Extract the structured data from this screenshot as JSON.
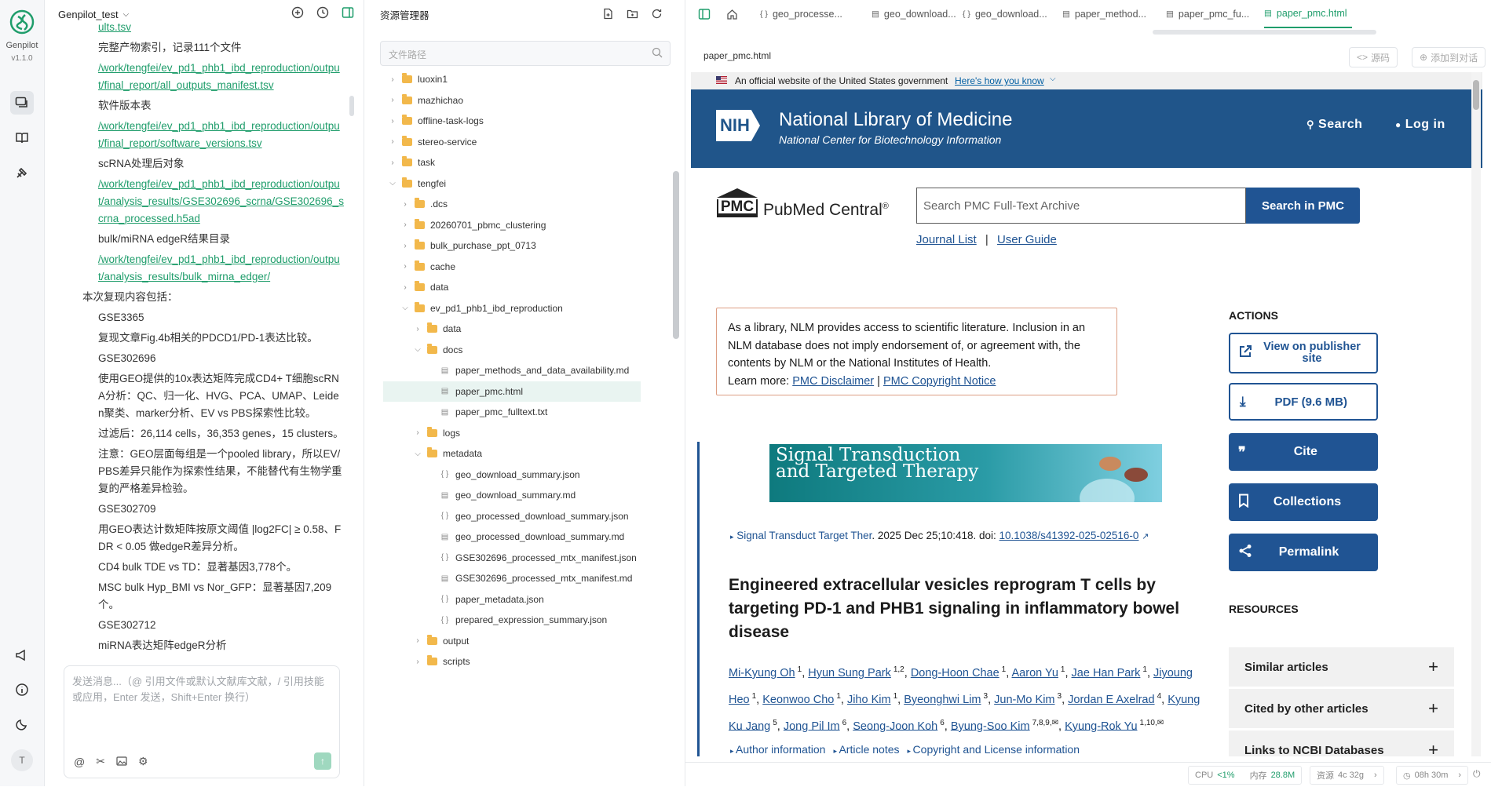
{
  "app": {
    "name": "Genpilot",
    "version": "v1.1.0"
  },
  "chat": {
    "project": "Genpilot_test",
    "lines": [
      {
        "text": "ults.tsv",
        "link": true,
        "level": 2
      },
      {
        "text": "完整产物索引，记录111个文件",
        "link": false,
        "level": 2
      },
      {
        "text": "/work/tengfei/ev_pd1_phb1_ibd_reproduction/output/final_report/all_outputs_manifest.tsv",
        "link": true,
        "level": 2
      },
      {
        "text": "软件版本表",
        "link": false,
        "level": 2
      },
      {
        "text": "/work/tengfei/ev_pd1_phb1_ibd_reproduction/output/final_report/software_versions.tsv",
        "link": true,
        "level": 2
      },
      {
        "text": "scRNA处理后对象",
        "link": false,
        "level": 2
      },
      {
        "text": "/work/tengfei/ev_pd1_phb1_ibd_reproduction/output/analysis_results/GSE302696_scrna/GSE302696_scrna_processed.h5ad",
        "link": true,
        "level": 2
      },
      {
        "text": "bulk/miRNA edgeR结果目录",
        "link": false,
        "level": 2
      },
      {
        "text": "/work/tengfei/ev_pd1_phb1_ibd_reproduction/output/analysis_results/bulk_mirna_edger/",
        "link": true,
        "level": 2
      },
      {
        "text": "本次复现内容包括：",
        "link": false,
        "level": 1
      },
      {
        "text": "GSE3365",
        "link": false,
        "level": 2
      },
      {
        "text": "复现文章Fig.4b相关的PDCD1/PD-1表达比较。",
        "link": false,
        "level": 2
      },
      {
        "text": "GSE302696",
        "link": false,
        "level": 2
      },
      {
        "text": "使用GEO提供的10x表达矩阵完成CD4+ T细胞scRNA分析：QC、归一化、HVG、PCA、UMAP、Leiden聚类、marker分析、EV vs PBS探索性比较。",
        "link": false,
        "level": 2
      },
      {
        "text": "过滤后：26,114 cells，36,353 genes，15 clusters。",
        "link": false,
        "level": 2
      },
      {
        "text": "注意：GEO层面每组是一个pooled library，所以EV/PBS差异只能作为探索性结果，不能替代有生物学重复的严格差异检验。",
        "link": false,
        "level": 2
      },
      {
        "text": "GSE302709",
        "link": false,
        "level": 2
      },
      {
        "text": "用GEO表达计数矩阵按原文阈值 |log2FC| ≥ 0.58、FDR < 0.05 做edgeR差异分析。",
        "link": false,
        "level": 2
      },
      {
        "text": "CD4 bulk TDE vs TD：显著基因3,778个。",
        "link": false,
        "level": 2
      },
      {
        "text": "MSC bulk Hyp_BMI vs Nor_GFP：显著基因7,209个。",
        "link": false,
        "level": 2
      },
      {
        "text": "GSE302712",
        "link": false,
        "level": 2
      },
      {
        "text": "miRNA表达矩阵edgeR分析",
        "link": false,
        "level": 2
      }
    ],
    "composer_placeholder": "发送消息...（@ 引用文件或默认文献库文献，/ 引用技能或应用，Enter 发送，Shift+Enter 换行）"
  },
  "explorer": {
    "title": "资源管理器",
    "search_placeholder": "文件路径",
    "items": [
      {
        "name": "luoxin1",
        "type": "folder",
        "depth": 0,
        "expanded": false,
        "selected": false
      },
      {
        "name": "mazhichao",
        "type": "folder",
        "depth": 0,
        "expanded": false,
        "selected": false
      },
      {
        "name": "offline-task-logs",
        "type": "folder",
        "depth": 0,
        "expanded": false,
        "selected": false
      },
      {
        "name": "stereo-service",
        "type": "folder",
        "depth": 0,
        "expanded": false,
        "selected": false
      },
      {
        "name": "task",
        "type": "folder",
        "depth": 0,
        "expanded": false,
        "selected": false
      },
      {
        "name": "tengfei",
        "type": "folder",
        "depth": 0,
        "expanded": true,
        "selected": false
      },
      {
        "name": ".dcs",
        "type": "folder",
        "depth": 1,
        "expanded": false,
        "selected": false
      },
      {
        "name": "20260701_pbmc_clustering",
        "type": "folder",
        "depth": 1,
        "expanded": false,
        "selected": false
      },
      {
        "name": "bulk_purchase_ppt_0713",
        "type": "folder",
        "depth": 1,
        "expanded": false,
        "selected": false
      },
      {
        "name": "cache",
        "type": "folder",
        "depth": 1,
        "expanded": false,
        "selected": false
      },
      {
        "name": "data",
        "type": "folder",
        "depth": 1,
        "expanded": false,
        "selected": false
      },
      {
        "name": "ev_pd1_phb1_ibd_reproduction",
        "type": "folder",
        "depth": 1,
        "expanded": true,
        "selected": false
      },
      {
        "name": "data",
        "type": "folder",
        "depth": 2,
        "expanded": false,
        "selected": false
      },
      {
        "name": "docs",
        "type": "folder",
        "depth": 2,
        "expanded": true,
        "selected": false
      },
      {
        "name": "paper_methods_and_data_availability.md",
        "type": "md",
        "depth": 3,
        "expanded": false,
        "selected": false
      },
      {
        "name": "paper_pmc.html",
        "type": "html",
        "depth": 3,
        "expanded": false,
        "selected": true
      },
      {
        "name": "paper_pmc_fulltext.txt",
        "type": "txt",
        "depth": 3,
        "expanded": false,
        "selected": false
      },
      {
        "name": "logs",
        "type": "folder",
        "depth": 2,
        "expanded": false,
        "selected": false
      },
      {
        "name": "metadata",
        "type": "folder",
        "depth": 2,
        "expanded": true,
        "selected": false
      },
      {
        "name": "geo_download_summary.json",
        "type": "json",
        "depth": 3,
        "expanded": false,
        "selected": false
      },
      {
        "name": "geo_download_summary.md",
        "type": "md",
        "depth": 3,
        "expanded": false,
        "selected": false
      },
      {
        "name": "geo_processed_download_summary.json",
        "type": "json",
        "depth": 3,
        "expanded": false,
        "selected": false
      },
      {
        "name": "geo_processed_download_summary.md",
        "type": "md",
        "depth": 3,
        "expanded": false,
        "selected": false
      },
      {
        "name": "GSE302696_processed_mtx_manifest.json",
        "type": "json",
        "depth": 3,
        "expanded": false,
        "selected": false
      },
      {
        "name": "GSE302696_processed_mtx_manifest.md",
        "type": "md",
        "depth": 3,
        "expanded": false,
        "selected": false
      },
      {
        "name": "paper_metadata.json",
        "type": "json",
        "depth": 3,
        "expanded": false,
        "selected": false
      },
      {
        "name": "prepared_expression_summary.json",
        "type": "json",
        "depth": 3,
        "expanded": false,
        "selected": false
      },
      {
        "name": "output",
        "type": "folder",
        "depth": 2,
        "expanded": false,
        "selected": false
      },
      {
        "name": "scripts",
        "type": "folder",
        "depth": 2,
        "expanded": false,
        "selected": false
      }
    ]
  },
  "tabs": [
    {
      "label": "geo_processe...",
      "icon": "{ }",
      "active": false
    },
    {
      "label": "geo_download...",
      "icon": "md",
      "active": false
    },
    {
      "label": "geo_download...",
      "icon": "{ }",
      "active": false
    },
    {
      "label": "paper_method...",
      "icon": "md",
      "active": false
    },
    {
      "label": "paper_pmc_fu...",
      "icon": "txt",
      "active": false
    },
    {
      "label": "paper_pmc.html",
      "icon": "html",
      "active": true
    }
  ],
  "preview": {
    "filename": "paper_pmc.html",
    "source_label": "源码",
    "add_chat_label": "添加到对话"
  },
  "web": {
    "gov_banner": "An official website of the United States government",
    "gov_link": "Here's how you know",
    "nih_badge": "NIH",
    "nlm_title": "National Library of Medicine",
    "nlm_subtitle": "National Center for Biotechnology Information",
    "search_label": "Search",
    "login_label": "Log in",
    "pmc_badge": "PMC",
    "pmc_name": "PubMed Central",
    "pmc_reg": "®",
    "search_placeholder": "Search PMC Full-Text Archive",
    "search_button": "Search in PMC",
    "journal_list": "Journal List",
    "user_guide": "User Guide",
    "sep": "|",
    "disclaimer_text": "As a library, NLM provides access to scientific literature. Inclusion in an NLM database does not imply endorsement of, or agreement with, the contents by NLM or the National Institutes of Health.",
    "learn_more": "Learn more:",
    "disclaimer_link": "PMC Disclaimer",
    "copyright_link": "PMC Copyright Notice",
    "journal_banner_line1": "Signal Transduction",
    "journal_banner_line2": "and Targeted Therapy",
    "citation_journal": "Signal Transduct Target Ther",
    "citation_rest": ". 2025 Dec 25;10:418. doi: ",
    "doi": "10.1038/s41392-025-02516-0",
    "article_title": "Engineered extracellular vesicles reprogram T cells by targeting PD-1 and PHB1 signaling in inflammatory bowel disease",
    "authors": [
      {
        "name": "Mi-Kyung Oh",
        "sup": "1"
      },
      {
        "name": "Hyun Sung Park",
        "sup": "1,2"
      },
      {
        "name": "Dong-Hoon Chae",
        "sup": "1"
      },
      {
        "name": "Aaron Yu",
        "sup": "1"
      },
      {
        "name": "Jae Han Park",
        "sup": "1"
      },
      {
        "name": "Jiyoung Heo",
        "sup": "1"
      },
      {
        "name": "Keonwoo Cho",
        "sup": "1"
      },
      {
        "name": "Jiho Kim",
        "sup": "1"
      },
      {
        "name": "Byeonghwi Lim",
        "sup": "3"
      },
      {
        "name": "Jun-Mo Kim",
        "sup": "3"
      },
      {
        "name": "Jordan E Axelrad",
        "sup": "4"
      },
      {
        "name": "Kyung Ku Jang",
        "sup": "5"
      },
      {
        "name": "Jong Pil Im",
        "sup": "6"
      },
      {
        "name": "Seong-Joon Koh",
        "sup": "6"
      },
      {
        "name": "Byung-Soo Kim",
        "sup": "7,8,9,✉"
      },
      {
        "name": "Kyung-Rok Yu",
        "sup": "1,10,✉"
      }
    ],
    "info_links": [
      "Author information",
      "Article notes",
      "Copyright and License information"
    ],
    "actions_heading": "ACTIONS",
    "view_publisher": "View on publisher site",
    "pdf": "PDF (9.6 MB)",
    "cite": "Cite",
    "collections": "Collections",
    "permalink": "Permalink",
    "resources_heading": "RESOURCES",
    "resources": [
      "Similar articles",
      "Cited by other articles",
      "Links to NCBI Databases"
    ]
  },
  "status": {
    "cpu_label": "CPU",
    "cpu_value": "<1%",
    "mem_label": "内存",
    "mem_value": "28.8M",
    "res_label": "资源",
    "res_value": "4c 32g",
    "time": "08h 30m"
  }
}
